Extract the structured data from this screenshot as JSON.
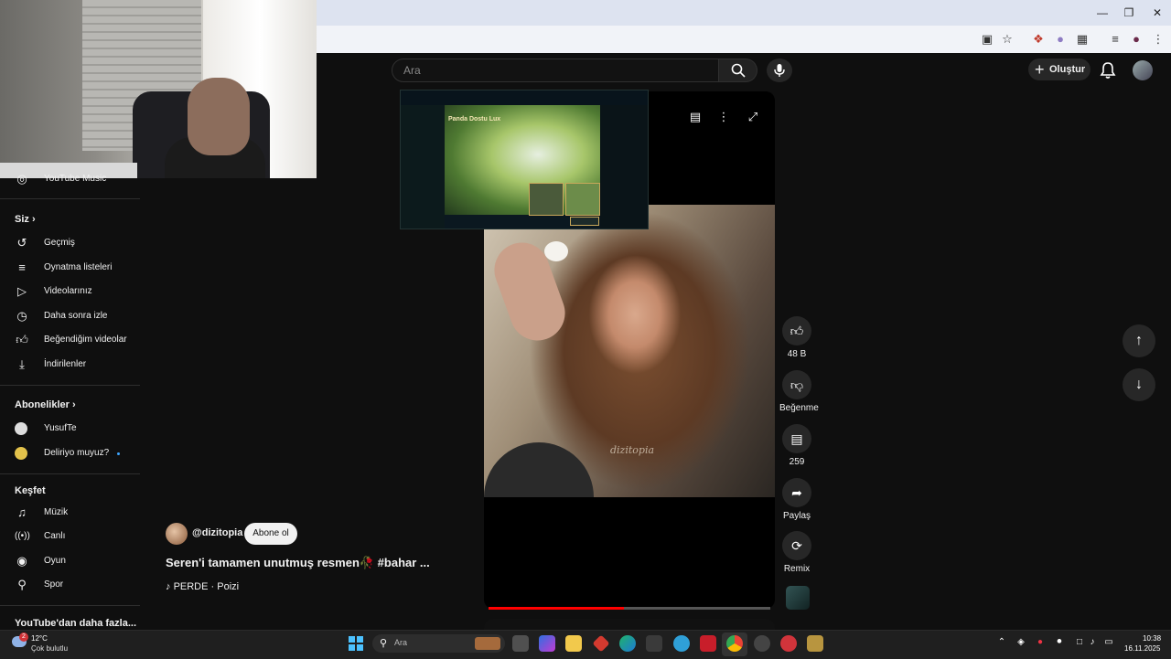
{
  "search": {
    "placeholder": "Ara"
  },
  "header": {
    "create_label": "Oluştur"
  },
  "sidebar": {
    "top_item": "YouTube Music",
    "you_header": "Siz",
    "you_items": [
      "Geçmiş",
      "Oynatma listeleri",
      "Videolarınız",
      "Daha sonra izle",
      "Beğendiğim videolar",
      "İndirilenler"
    ],
    "subs_header": "Abonelikler",
    "subs": [
      "YusufTe",
      "Deliriyo muyuz?"
    ],
    "explore_header": "Keşfet",
    "explore_items": [
      "Müzik",
      "Canlı",
      "Oyun",
      "Spor"
    ],
    "more_header": "YouTube'dan daha fazla..."
  },
  "video": {
    "watermark": "dizitopia",
    "progress_fraction": 0.48,
    "inset_title": "Panda Dostu Lux"
  },
  "channel": {
    "handle": "@dizitopia",
    "subscribe_label": "Abone ol",
    "title": "Seren'i tamamen unutmuş resmen🥀 #bahar ...",
    "music": "PERDE · Poizi"
  },
  "actions": {
    "likes": "48 B",
    "dislike_label": "Beğenme",
    "comments": "259",
    "share_label": "Paylaş",
    "remix_label": "Remix"
  },
  "taskbar": {
    "badge": "2",
    "temp": "12°C",
    "condition": "Çok bulutlu",
    "search_placeholder": "Ara",
    "time": "10:38",
    "date": "16.11.2025"
  },
  "colors": {
    "accent": "#ff0000",
    "background": "#0f0f0f",
    "chip": "#272727"
  }
}
